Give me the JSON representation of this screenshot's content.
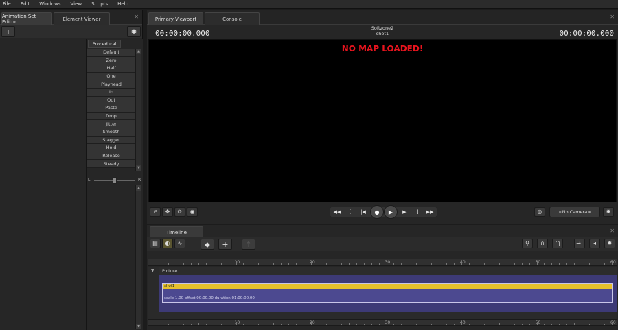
{
  "menubar": {
    "items": [
      "File",
      "Edit",
      "Windows",
      "View",
      "Scripts",
      "Help"
    ]
  },
  "left_panel": {
    "tabs": [
      "Animation Set Editor",
      "Element Viewer"
    ],
    "procedural_tab": "Procedural",
    "procedural_items": [
      "Default",
      "Zero",
      "Half",
      "One",
      "Playhead",
      "In",
      "Out",
      "Paste",
      "Drop",
      "Jitter",
      "Smooth",
      "Stagger",
      "Hold",
      "Release",
      "Steady"
    ],
    "balance": {
      "left": "L",
      "right": "R",
      "value_fraction": 0.5
    }
  },
  "viewport": {
    "tabs": [
      "Primary Viewport",
      "Console"
    ],
    "session_name": "Softzone2",
    "shot_name": "shot1",
    "timecode_left": "00:00:00.000",
    "timecode_right": "00:00:00.000",
    "message": "NO MAP LOADED!",
    "camera_label": "<No Camera>"
  },
  "timeline": {
    "tab": "Timeline",
    "ruler_ticks": [
      "10",
      "20",
      "30",
      "40",
      "50",
      "60"
    ],
    "track_label": "Picture",
    "clip_name": "shot1",
    "clip_info": "scale 1.00 offset  00:00.00 duration  01:00:00.00"
  },
  "icons": {
    "add": "plus-icon",
    "settings": "gear-icon",
    "close": "close-icon"
  },
  "colors": {
    "no_map_text": "#e8141e",
    "clip_bar": "#e6c02c",
    "track_band": "#3d3a76"
  }
}
